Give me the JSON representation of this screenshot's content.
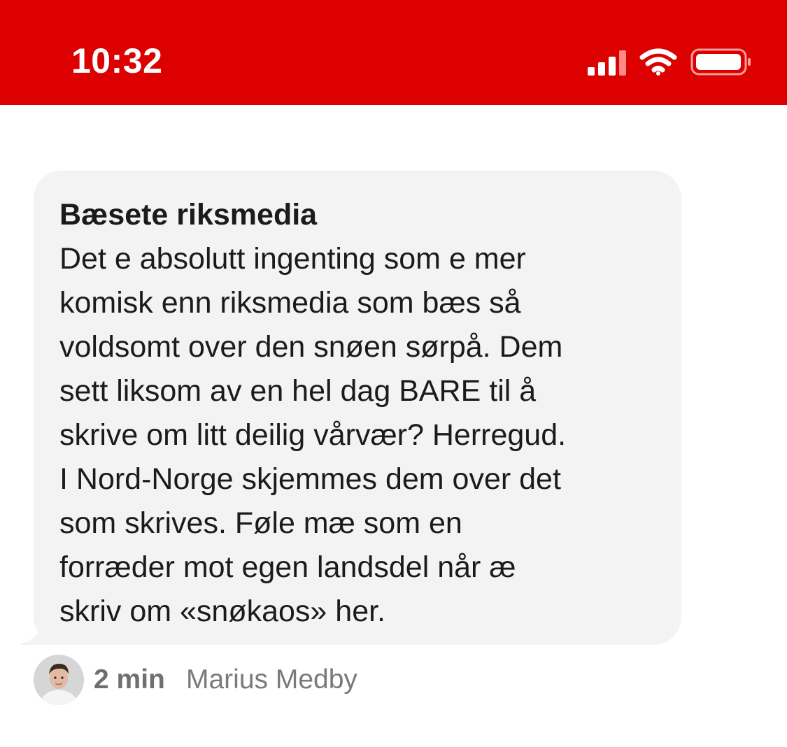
{
  "status_bar": {
    "time": "10:32",
    "background_color": "#dc0000",
    "icons": [
      "signal-icon",
      "wifi-icon",
      "battery-icon"
    ]
  },
  "message": {
    "title": "Bæsete riksmedia",
    "lines": [
      "Det e absolutt ingenting som e mer",
      "komisk enn riksmedia som bæs så",
      "voldsomt over den snøen sørpå. Dem",
      "sett liksom av en hel dag BARE til å",
      "skrive om litt deilig vårvær? Herregud.",
      "I Nord-Norge skjemmes dem over det",
      "som skrives. Føle mæ som en",
      "forræder mot egen landsdel når æ",
      "skriv om «snøkaos» her."
    ],
    "bubble_color": "#f3f3f3"
  },
  "meta": {
    "time_ago": "2 min",
    "author": "Marius Medby",
    "avatar_icon": "avatar-photo"
  }
}
